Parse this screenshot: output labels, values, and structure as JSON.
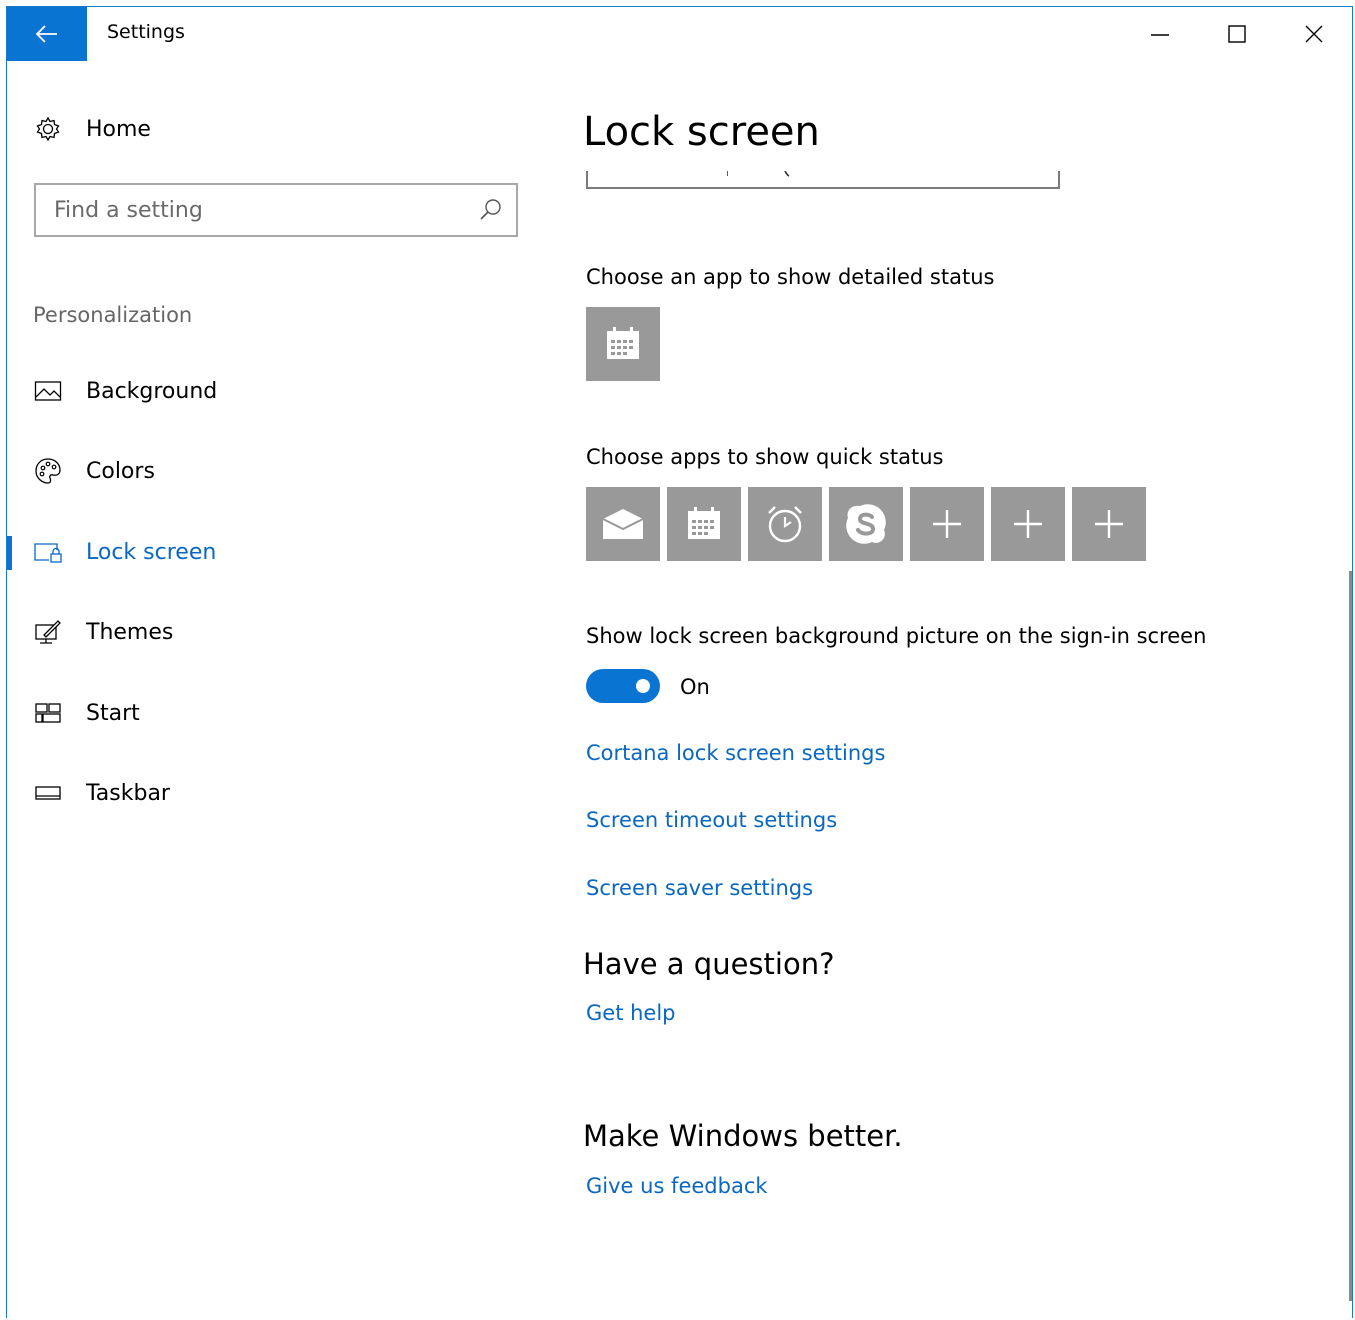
{
  "window": {
    "title": "Settings"
  },
  "sidebar": {
    "home_label": "Home",
    "search_placeholder": "Find a setting",
    "section_title": "Personalization",
    "items": [
      {
        "label": "Background",
        "icon": "picture-icon"
      },
      {
        "label": "Colors",
        "icon": "palette-icon"
      },
      {
        "label": "Lock screen",
        "icon": "lock-screen-icon",
        "active": true
      },
      {
        "label": "Themes",
        "icon": "themes-icon"
      },
      {
        "label": "Start",
        "icon": "start-tiles-icon"
      },
      {
        "label": "Taskbar",
        "icon": "taskbar-icon"
      }
    ]
  },
  "main": {
    "page_title": "Lock screen",
    "detailed_status_label": "Choose an app to show detailed status",
    "detailed_status_app": {
      "icon": "calendar-icon"
    },
    "quick_status_label": "Choose apps to show quick status",
    "quick_status_apps": [
      {
        "icon": "mail-icon"
      },
      {
        "icon": "calendar-icon"
      },
      {
        "icon": "alarm-clock-icon"
      },
      {
        "icon": "skype-icon"
      },
      {
        "icon": "plus-icon"
      },
      {
        "icon": "plus-icon"
      },
      {
        "icon": "plus-icon"
      }
    ],
    "signin_bg_label": "Show lock screen background picture on the sign-in screen",
    "signin_bg_toggle": {
      "state_label": "On",
      "on": true
    },
    "links": {
      "cortana": "Cortana lock screen settings",
      "timeout": "Screen timeout settings",
      "screensaver": "Screen saver settings"
    },
    "question_heading": "Have a question?",
    "get_help": "Get help",
    "better_heading": "Make Windows better.",
    "feedback": "Give us feedback"
  },
  "colors": {
    "accent": "#0a74d3",
    "link": "#0a67c2",
    "tile": "#999999"
  }
}
